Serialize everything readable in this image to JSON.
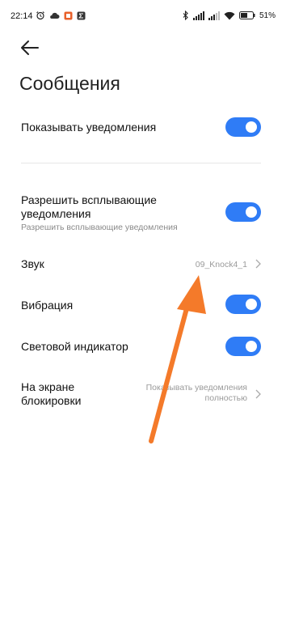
{
  "status_bar": {
    "time": "22:14",
    "battery": "51%"
  },
  "page": {
    "title": "Сообщения"
  },
  "settings": {
    "show_notifications": {
      "label": "Показывать уведомления",
      "enabled": true
    },
    "popup": {
      "label_line1": "Разрешить всплывающие",
      "label_line2": "уведомления",
      "subtitle": "Разрешить всплывающие уведомления",
      "enabled": true
    },
    "sound": {
      "label": "Звук",
      "value": "09_Knock4_1"
    },
    "vibration": {
      "label": "Вибрация",
      "enabled": true
    },
    "led": {
      "label": "Световой индикатор",
      "enabled": true
    },
    "lockscreen": {
      "label_line1": "На экране",
      "label_line2": "блокировки",
      "value_line1": "Показывать уведомления",
      "value_line2": "полностью"
    }
  },
  "colors": {
    "accent": "#2f7cf6",
    "annotation_arrow": "#f47a2a"
  }
}
